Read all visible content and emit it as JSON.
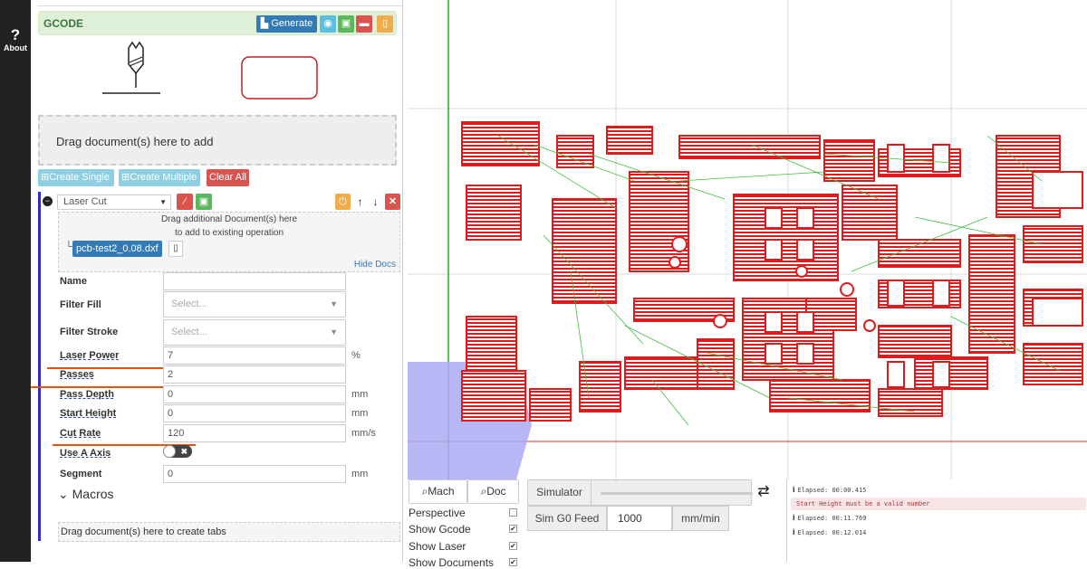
{
  "sidebar": {
    "about_label": "About",
    "about_icon": "question-icon"
  },
  "gcode": {
    "title": "GCODE",
    "generate_label": "Generate",
    "icons": [
      "eye-icon",
      "save-icon",
      "folder-icon",
      "trash-icon"
    ]
  },
  "documents": {
    "dropzone_text": "Drag document(s) here to add",
    "create_single": "Create Single",
    "create_multiple": "Create Multiple",
    "clear_all": "Clear All"
  },
  "operation": {
    "type": "Laser Cut",
    "drop_line1": "Drag additional Document(s) here",
    "drop_line2": "to add to existing operation",
    "doc_name": "pcb-test2_0.08.dxf",
    "hide_docs": "Hide Docs",
    "fields": {
      "name": {
        "label": "Name",
        "value": ""
      },
      "filter_fill": {
        "label": "Filter Fill",
        "placeholder": "Select..."
      },
      "filter_stroke": {
        "label": "Filter Stroke",
        "placeholder": "Select..."
      },
      "laser_power": {
        "label": "Laser Power",
        "value": "7",
        "unit": "%"
      },
      "passes": {
        "label": "Passes",
        "value": "2"
      },
      "pass_depth": {
        "label": "Pass Depth",
        "value": "0",
        "unit": "mm"
      },
      "start_height": {
        "label": "Start Height",
        "value": "0",
        "unit": "mm"
      },
      "cut_rate": {
        "label": "Cut Rate",
        "value": "120",
        "unit": "mm/s"
      },
      "use_a_axis": {
        "label": "Use A Axis",
        "toggle_off": "✖"
      },
      "segment": {
        "label": "Segment",
        "value": "0",
        "unit": "mm"
      }
    },
    "macros_label": "Macros",
    "tabs_drop": "Drag document(s) here to create tabs"
  },
  "viewport": {
    "mach_label": "Mach",
    "doc_label": "Doc",
    "checkboxes": [
      {
        "label": "Perspective",
        "checked": false
      },
      {
        "label": "Show Gcode",
        "checked": true
      },
      {
        "label": "Show Laser",
        "checked": true
      },
      {
        "label": "Show Documents",
        "checked": true
      }
    ],
    "simulator_label": "Simulator",
    "sim_feed_label": "Sim G0 Feed",
    "sim_feed_value": "1000",
    "sim_feed_unit": "mm/min"
  },
  "console": [
    {
      "text": "Elapsed: 00:00.415",
      "error": false
    },
    {
      "text": "Start Height must be a valid number",
      "error": true
    },
    {
      "text": "Elapsed: 00:11.769",
      "error": false
    },
    {
      "text": "Elapsed: 00:12.014",
      "error": false
    }
  ],
  "colors": {
    "trace": "#e01b1b",
    "travel": "#3fbf3f",
    "highlight": "#e8530e",
    "operation_bar": "#2b2bd1"
  }
}
